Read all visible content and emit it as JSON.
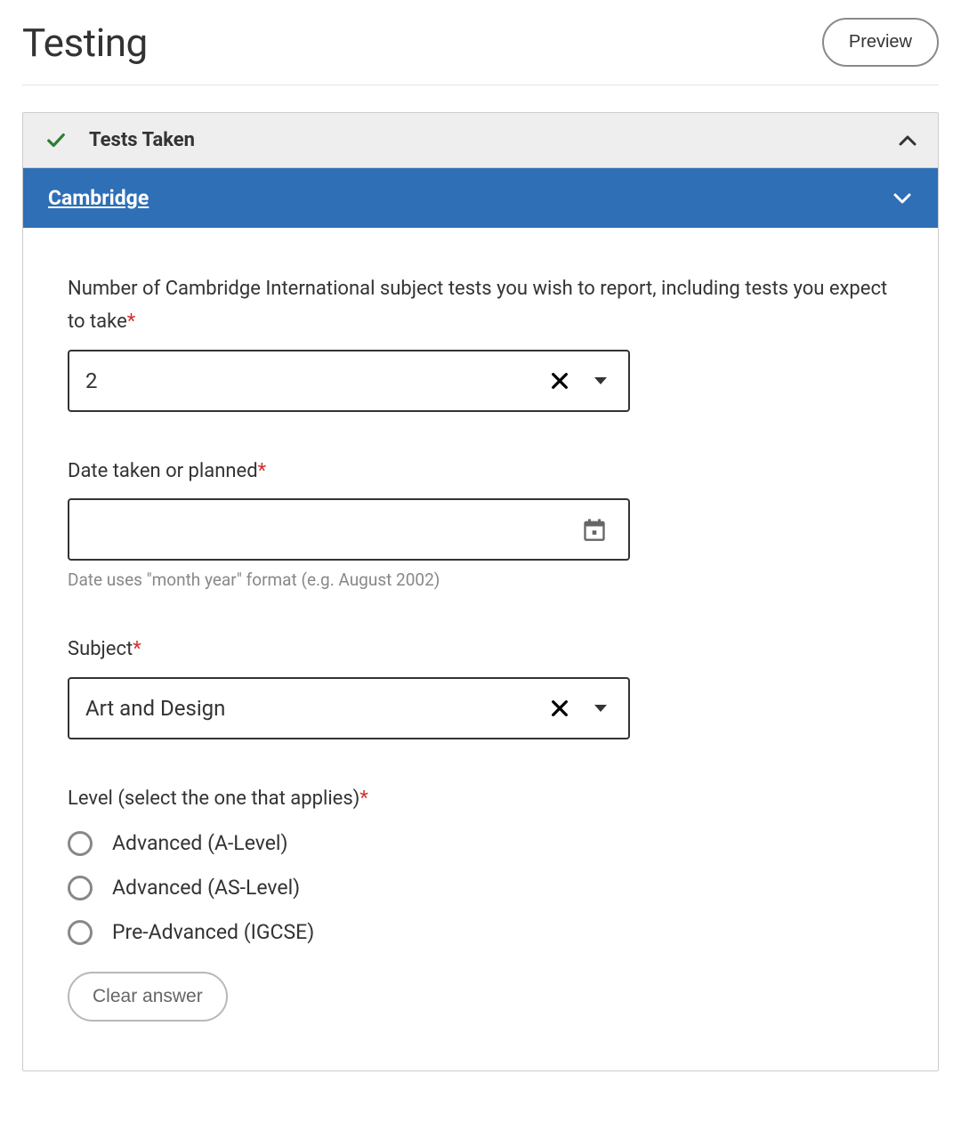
{
  "header": {
    "title": "Testing",
    "preview_label": "Preview"
  },
  "section": {
    "title": "Tests Taken"
  },
  "sub_section": {
    "title": "Cambridge"
  },
  "fields": {
    "count": {
      "label": "Number of Cambridge International subject tests you wish to report, including tests you expect to take",
      "value": "2"
    },
    "date": {
      "label": "Date taken or planned",
      "value": "",
      "helper": "Date uses \"month year\" format (e.g. August 2002)"
    },
    "subject": {
      "label": "Subject",
      "value": "Art and Design"
    },
    "level": {
      "label": "Level (select the one that applies)",
      "options": [
        "Advanced (A-Level)",
        "Advanced (AS-Level)",
        "Pre-Advanced (IGCSE)"
      ],
      "clear_label": "Clear answer"
    }
  },
  "required_marker": "*"
}
